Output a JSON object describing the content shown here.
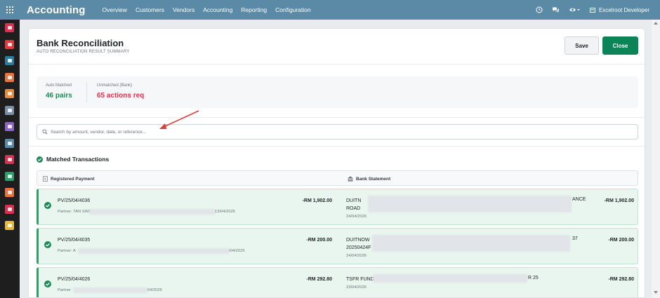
{
  "app": {
    "name": "Accounting"
  },
  "menu": [
    "Overview",
    "Customers",
    "Vendors",
    "Accounting",
    "Reporting",
    "Configuration"
  ],
  "user": {
    "name": "Excelroot Developer"
  },
  "sidebar": {
    "colors": [
      "#d9304f",
      "#e03b3b",
      "#2d7d9a",
      "#e8743b",
      "#e88a3b",
      "#7a8fa6",
      "#8a65c2",
      "#5a8aa6",
      "#d9304f",
      "#2e9e6a",
      "#e8743b",
      "#d9304f",
      "#e8b83b"
    ]
  },
  "page": {
    "title": "Bank Reconciliation",
    "subtitle": "AUTO RECONCILIATION RESULT SUMMARY",
    "save_label": "Save",
    "close_label": "Close"
  },
  "summary": {
    "auto_label": "Auto Matched",
    "auto_value": "46 pairs",
    "unmatched_label": "Unmatched (Bank)",
    "unmatched_value": "65 actions req"
  },
  "search": {
    "placeholder": "Search by amount, vendor, date, or reference..."
  },
  "matched": {
    "title": "Matched Transactions",
    "col_registered": "Registered Payment",
    "col_bank": "Bank Statement",
    "rows": [
      {
        "pv": "PV/25/04/4036",
        "partner_prefix": "Partner: TAN SWEE",
        "partner_suffix": "13/04/2025",
        "amount": "-RM 1,902.00",
        "bank_prefix": "DUITN",
        "bank_suffix": "ANCE",
        "bank_line2": "ROAD",
        "bank_date": "24/04/2026",
        "bank_amount": "-RM 1,902.00"
      },
      {
        "pv": "PV/25/04/4035",
        "partner_prefix": "Partner: A",
        "partner_suffix": "/04/2025",
        "amount": "-RM 200.00",
        "bank_prefix": "DUITNOW",
        "bank_suffix": "37",
        "bank_line2": "20250424F",
        "bank_date": "24/04/2026",
        "bank_amount": "-RM 200.00"
      },
      {
        "pv": "PV/25/04/4026",
        "partner_prefix": "Partner",
        "partner_suffix": "04/2025",
        "amount": "-RM 292.80",
        "bank_prefix": "TSFR FUND",
        "bank_suffix": "R 25",
        "bank_line2": "",
        "bank_date": "23/04/2026",
        "bank_amount": "-RM 292.80"
      }
    ]
  }
}
